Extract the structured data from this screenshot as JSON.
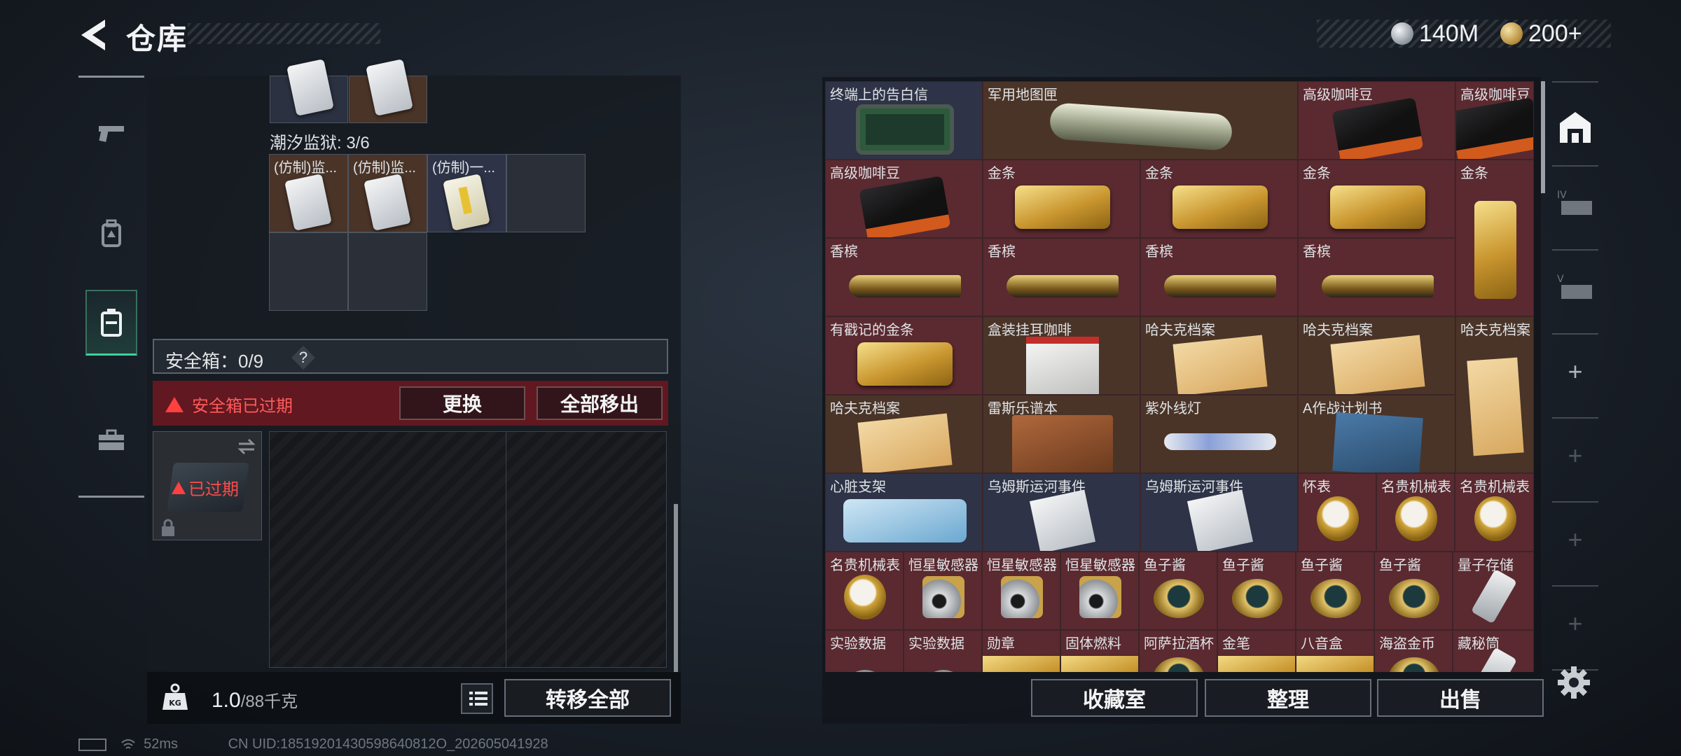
{
  "header": {
    "title": "仓库"
  },
  "currency": {
    "silver": "140M",
    "gold": "200+"
  },
  "left_nav": {
    "items": [
      {
        "id": "weapons",
        "icon": "gun-icon"
      },
      {
        "id": "gear",
        "icon": "backpack-icon"
      },
      {
        "id": "container",
        "icon": "safe-box-icon",
        "active": true
      },
      {
        "id": "tools",
        "icon": "toolbox-icon"
      }
    ]
  },
  "container": {
    "section_label": "潮汐监狱: 3/6",
    "items": [
      {
        "name": "(仿制)监..."
      },
      {
        "name": "(仿制)监..."
      },
      {
        "name": "(仿制)一..."
      }
    ]
  },
  "safe_box": {
    "label": "安全箱：0/9",
    "help": "?",
    "expired_warning": "安全箱已过期",
    "replace_label": "更换",
    "move_all_label": "全部移出",
    "thumb_status": "已过期"
  },
  "footer_left": {
    "weight_value": "1.0",
    "weight_max": "/88千克",
    "transfer_all_label": "转移全部"
  },
  "stash": {
    "rows": [
      [
        "终端上的告白信",
        "军用地图匣",
        "",
        "高级咖啡豆",
        "高级咖啡豆"
      ],
      [
        "高级咖啡豆",
        "金条",
        "金条",
        "金条",
        "金条"
      ],
      [
        "香槟",
        "香槟",
        "香槟",
        "香槟",
        ""
      ],
      [
        "有戳记的金条",
        "盒装挂耳咖啡",
        "哈夫克档案",
        "哈夫克档案",
        "哈夫克档案"
      ],
      [
        "哈夫克档案",
        "雷斯乐谱本",
        "紫外线灯",
        "A作战计划书",
        ""
      ],
      [
        "心脏支架",
        "乌姆斯运河事件",
        "乌姆斯运河事件",
        "怀表",
        "名贵机械表",
        "名贵机械表"
      ],
      [
        "名贵机械表",
        "恒星敏感器",
        "恒星敏感器",
        "恒星敏感器",
        "鱼子酱",
        "鱼子酱",
        "鱼子酱",
        "鱼子酱",
        "量子存储"
      ],
      [
        "实验数据",
        "实验数据",
        "勋章",
        "固体燃料",
        "阿萨拉酒杯",
        "金笔",
        "八音盒",
        "海盗金币",
        "藏秘筒"
      ]
    ]
  },
  "footer_right": {
    "collection_label": "收藏室",
    "organize_label": "整理",
    "sell_label": "出售"
  },
  "status": {
    "ping": "52ms",
    "uid": "CN UID:18519201430598640812O_202605041928"
  },
  "colors": {
    "accent": "#3fd29b",
    "danger": "#ff4a4a",
    "cell_red": "#5a2a30",
    "cell_blue": "#2e3347",
    "cell_brown": "#4a3428"
  }
}
